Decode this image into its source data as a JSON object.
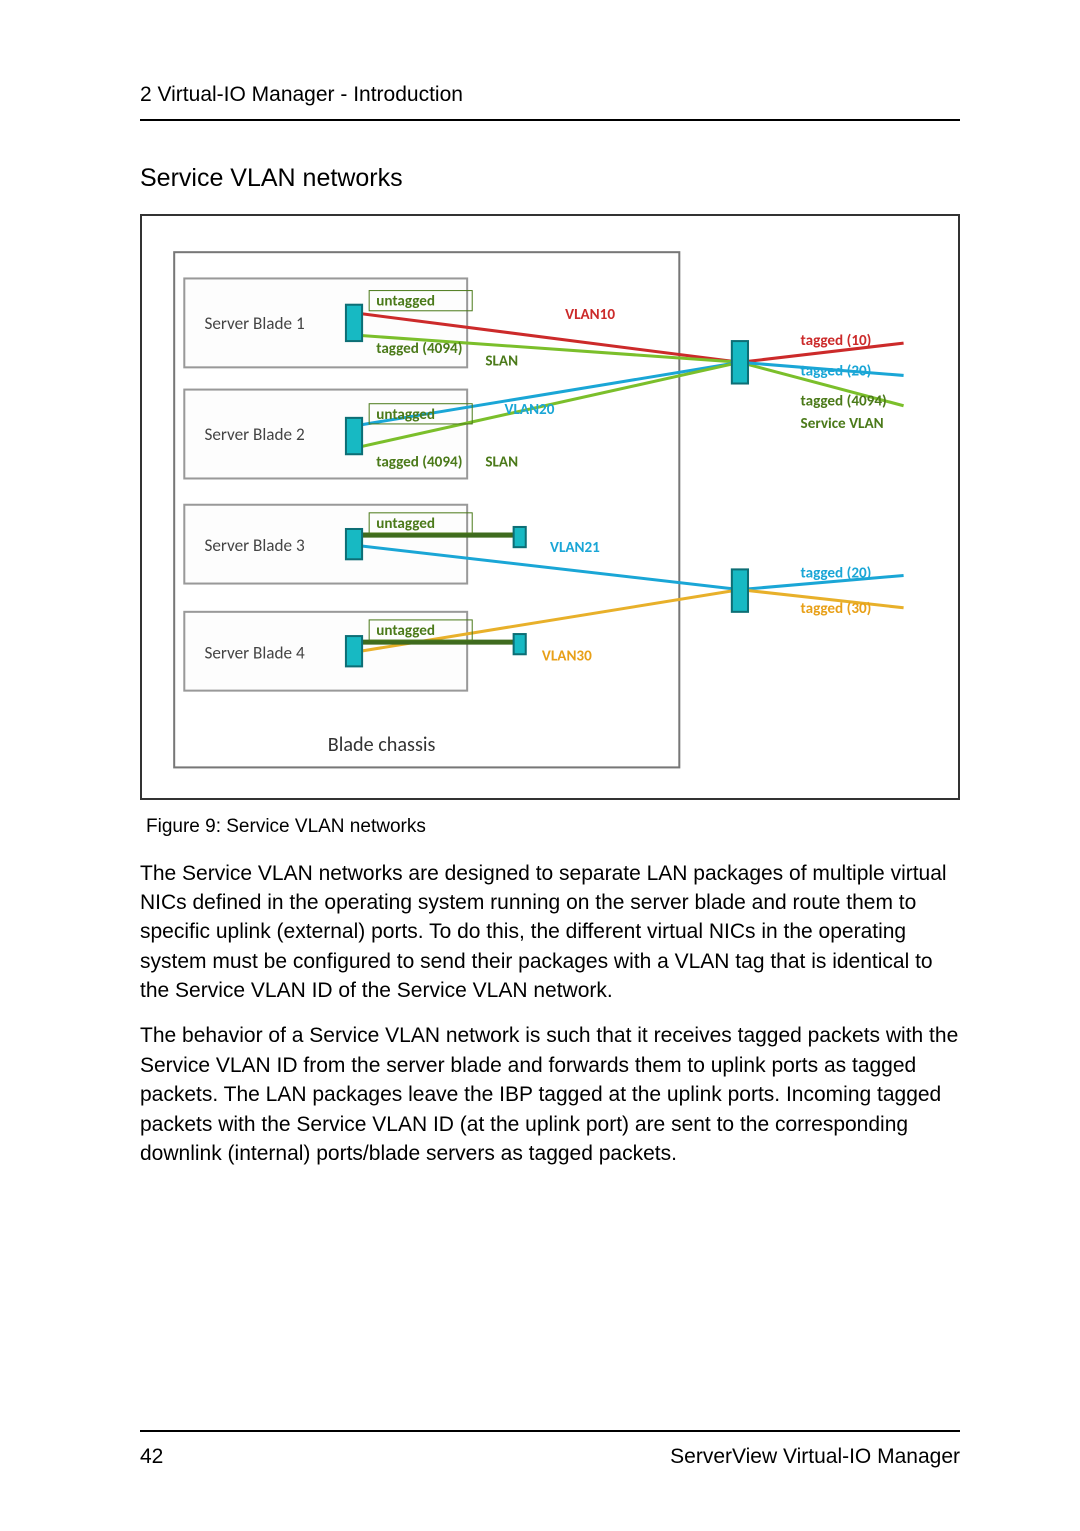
{
  "header": {
    "chapter": "2 Virtual-IO Manager - Introduction"
  },
  "section": {
    "title": "Service VLAN networks"
  },
  "figure": {
    "caption": "Figure 9: Service VLAN networks",
    "chassis_label": "Blade chassis",
    "blades": {
      "b1": "Server Blade 1",
      "b2": "Server Blade 2",
      "b3": "Server Blade 3",
      "b4": "Server Blade 4"
    },
    "tags": {
      "untagged": "untagged",
      "tagged4094": "tagged (4094)",
      "slan": "SLAN",
      "vlan10": "VLAN10",
      "vlan20": "VLAN20",
      "vlan21": "VLAN21",
      "vlan30": "VLAN30",
      "tagged10": "tagged (10)",
      "tagged20": "tagged (20)",
      "tagged30": "tagged (30)",
      "svcvlan": "Service VLAN"
    }
  },
  "body": {
    "p1": "The Service VLAN networks are designed to separate LAN packages of multiple virtual NICs defined in the operating system running on the server blade and route them to specific uplink (external) ports. To do this, the different virtual NICs in the operating system must be configured to send their packages with a VLAN tag that is identical to the Service VLAN ID of the Service VLAN network.",
    "p2": "The behavior of a Service VLAN network is such that it receives tagged packets with the Service VLAN ID from the server blade and forwards them to uplink ports as tagged packets. The LAN packages leave the IBP tagged at the uplink ports. Incoming tagged packets with the Service VLAN ID (at the uplink port) are sent to the corresponding downlink (internal) ports/blade servers as tagged packets."
  },
  "footer": {
    "page": "42",
    "product": "ServerView Virtual-IO Manager"
  }
}
